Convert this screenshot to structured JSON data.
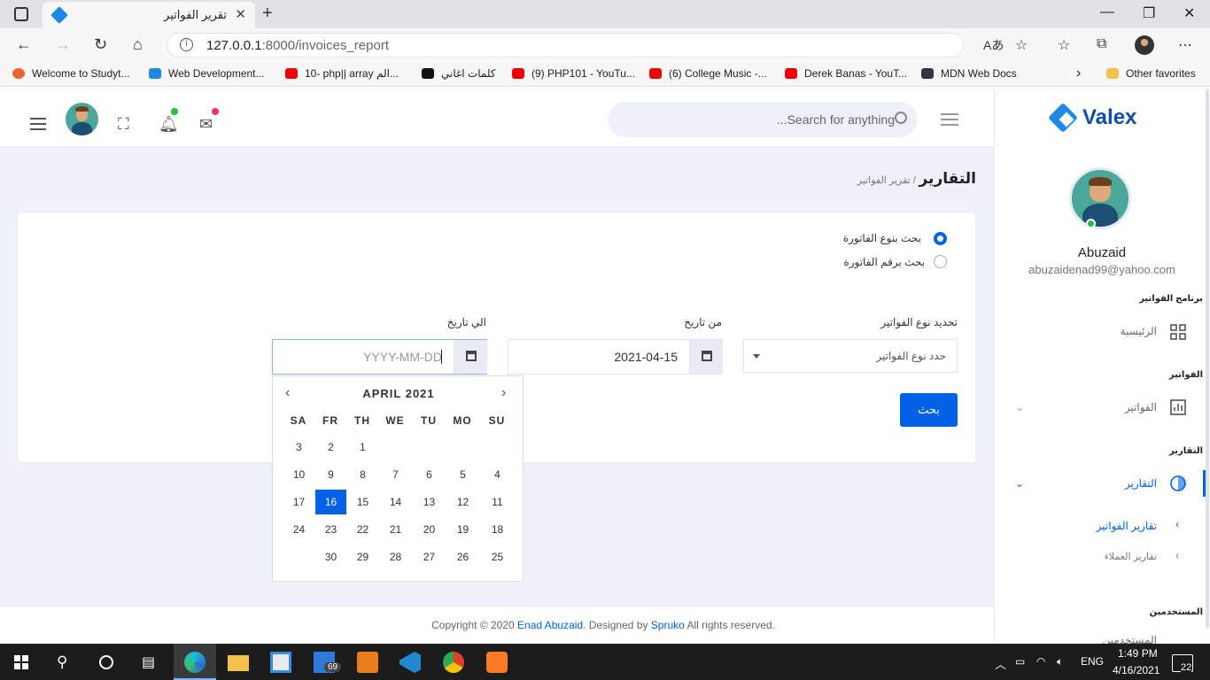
{
  "browser": {
    "tab_title": "تقرير الفواتير",
    "url_host": "127.0.0.1",
    "url_rest": ":8000/invoices_report",
    "bookmarks": [
      "Welcome to Studyt...",
      "Web Development...",
      "10- php|| array الم...",
      "كلمات اغاني",
      "(9) PHP101 - YouTu...",
      "(6) College Music -...",
      "Derek Banas - YouT...",
      "MDN Web Docs"
    ],
    "other_favorites": "Other favorites"
  },
  "header": {
    "search_placeholder": "Search for anything..."
  },
  "sidebar": {
    "brand": "Valex",
    "user_name": "Abuzaid",
    "user_email": "abuzaidenad99@yahoo.com",
    "section_program": "برنامج الفواتير",
    "item_home": "الرئيسية",
    "section_invoices": "الفواتير",
    "item_invoices": "الفواتير",
    "section_reports": "التقارير",
    "item_reports": "التقارير",
    "sub_invoice_reports": "تقارير الفواتير",
    "sub_customer_reports": "تقارير العملاء",
    "section_users": "المستخدمين",
    "item_users": "المستخدمين"
  },
  "breadcrumb": {
    "main": "التقارير",
    "sub": "/ تقرير الفواتير"
  },
  "form": {
    "radio_type": "بحث بنوع الفاتورة",
    "radio_number": "بحث برقم الفاتورة",
    "label_type": "تحديد نوع الفواتير",
    "type_value": "حدد نوع الفواتير",
    "label_from": "من تاريخ",
    "from_value": "2021-04-15",
    "label_to": "الي تاريخ",
    "to_placeholder": "YYYY-MM-DD",
    "submit": "بحث"
  },
  "datepicker": {
    "month": "APRIL 2021",
    "weekdays": [
      "SA",
      "FR",
      "TH",
      "WE",
      "TU",
      "MO",
      "SU"
    ],
    "selected_day": "16",
    "rows": [
      [
        "3",
        "2",
        "1",
        "",
        "",
        "",
        ""
      ],
      [
        "10",
        "9",
        "8",
        "7",
        "6",
        "5",
        "4"
      ],
      [
        "17",
        "16",
        "15",
        "14",
        "13",
        "12",
        "11"
      ],
      [
        "24",
        "23",
        "22",
        "21",
        "20",
        "19",
        "18"
      ],
      [
        "",
        "30",
        "29",
        "28",
        "27",
        "26",
        "25"
      ]
    ]
  },
  "footer": {
    "prefix": "Copyright © 2020 ",
    "author": "Enad Abuzaid",
    "middle": ". Designed by ",
    "designer": "Spruko",
    "suffix": " All rights reserved."
  },
  "taskbar": {
    "mail_badge": "69",
    "lang": "ENG",
    "time": "1:49 PM",
    "date": "4/16/2021",
    "notifications": "22"
  },
  "colors": {
    "primary": "#0162e8",
    "app_bg": "#eef1fa",
    "brand": "#0d4fa8"
  }
}
